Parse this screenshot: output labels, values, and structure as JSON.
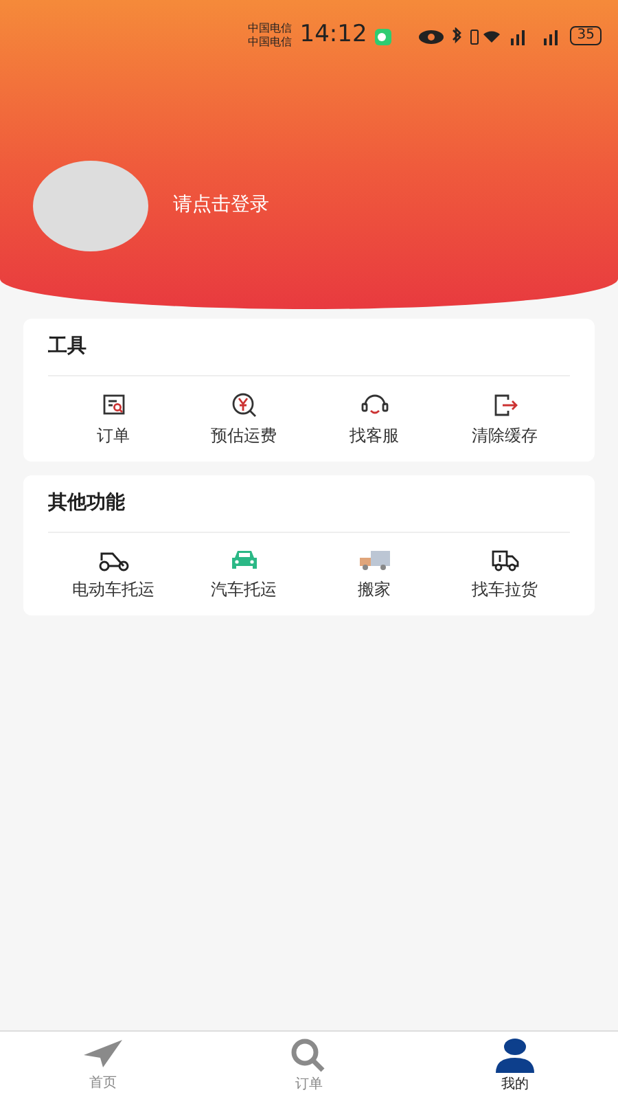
{
  "status_bar": {
    "carriers": [
      "中国电信",
      "中国电信"
    ],
    "time": "14:12",
    "battery": "35"
  },
  "profile": {
    "login_prompt": "请点击登录"
  },
  "sections": [
    {
      "title": "工具",
      "items": [
        {
          "label": "订单"
        },
        {
          "label": "预估运费"
        },
        {
          "label": "找客服"
        },
        {
          "label": "清除缓存"
        }
      ]
    },
    {
      "title": "其他功能",
      "items": [
        {
          "label": "电动车托运"
        },
        {
          "label": "汽车托运"
        },
        {
          "label": "搬家"
        },
        {
          "label": "找车拉货"
        }
      ]
    }
  ],
  "tabs": [
    {
      "label": "首页",
      "selected": false
    },
    {
      "label": "订单",
      "selected": false
    },
    {
      "label": "我的",
      "selected": true
    }
  ]
}
